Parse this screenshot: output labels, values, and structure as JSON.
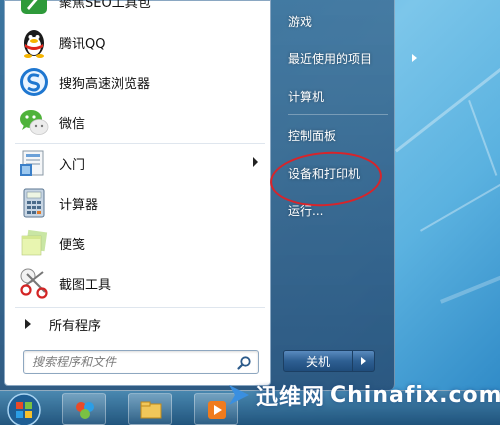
{
  "programs": [
    {
      "label": "聚焦SEO工具包",
      "icon": "seo-toolkit-icon"
    },
    {
      "label": "腾讯QQ",
      "icon": "qq-penguin-icon"
    },
    {
      "label": "搜狗高速浏览器",
      "icon": "sogou-browser-icon"
    },
    {
      "label": "微信",
      "icon": "wechat-icon"
    },
    {
      "label": "入门",
      "icon": "getting-started-icon",
      "has_submenu": true
    },
    {
      "label": "计算器",
      "icon": "calculator-icon"
    },
    {
      "label": "便笺",
      "icon": "sticky-notes-icon"
    },
    {
      "label": "截图工具",
      "icon": "snipping-tool-icon"
    }
  ],
  "all_programs_label": "所有程序",
  "search": {
    "placeholder": "搜索程序和文件"
  },
  "right_items": [
    {
      "label": "游戏"
    },
    {
      "label": "最近使用的项目",
      "has_submenu": true
    },
    {
      "label": "计算机"
    },
    {
      "label": "控制面板"
    },
    {
      "label": "设备和打印机",
      "highlighted": true
    },
    {
      "label": "运行..."
    }
  ],
  "shutdown": {
    "label": "关机"
  },
  "taskbar": {
    "buttons": [
      "start-orb",
      "program-icon",
      "explorer-icon",
      "media-player-icon"
    ]
  },
  "watermark": {
    "left_text": "迅维网",
    "right_text": "Chinafix.com"
  },
  "colors": {
    "highlight_circle": "#d8242a",
    "desktop": "#3aa0d6"
  }
}
